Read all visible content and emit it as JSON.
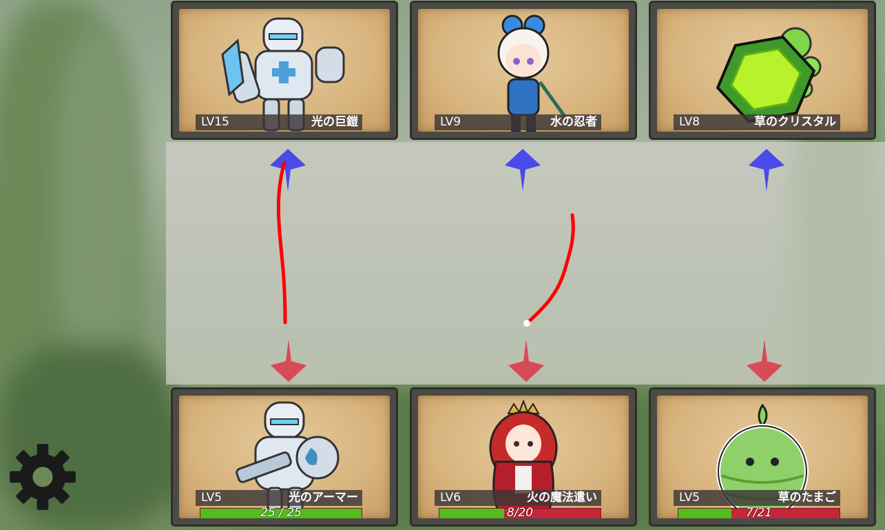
{
  "enemies": [
    {
      "level": "LV15",
      "name": "光の巨鎧",
      "portrait": "light-giant-armor",
      "color": "#c9d6e6"
    },
    {
      "level": "LV9",
      "name": "水の忍者",
      "portrait": "water-ninja",
      "color": "#5aa0e8"
    },
    {
      "level": "LV8",
      "name": "草のクリスタル",
      "portrait": "grass-crystal",
      "color": "#9ce23a"
    }
  ],
  "allies": [
    {
      "level": "LV5",
      "name": "光のアーマー",
      "portrait": "light-armor",
      "color": "#c9d6e6",
      "hp_text": "25 / 25",
      "hp_fraction": 1.0
    },
    {
      "level": "LV6",
      "name": "火の魔法遣い",
      "portrait": "fire-mage",
      "color": "#d8363a",
      "hp_text": "8/20",
      "hp_fraction": 0.4
    },
    {
      "level": "LV5",
      "name": "草のたまご",
      "portrait": "grass-egg",
      "color": "#7fc25a",
      "hp_text": "7/21",
      "hp_fraction": 0.33
    }
  ],
  "colors": {
    "enemy_marker": "#4a4ae8",
    "ally_marker": "#d84a55",
    "attack_line": "#ff0000"
  },
  "icons": {
    "settings": "gear-icon"
  }
}
